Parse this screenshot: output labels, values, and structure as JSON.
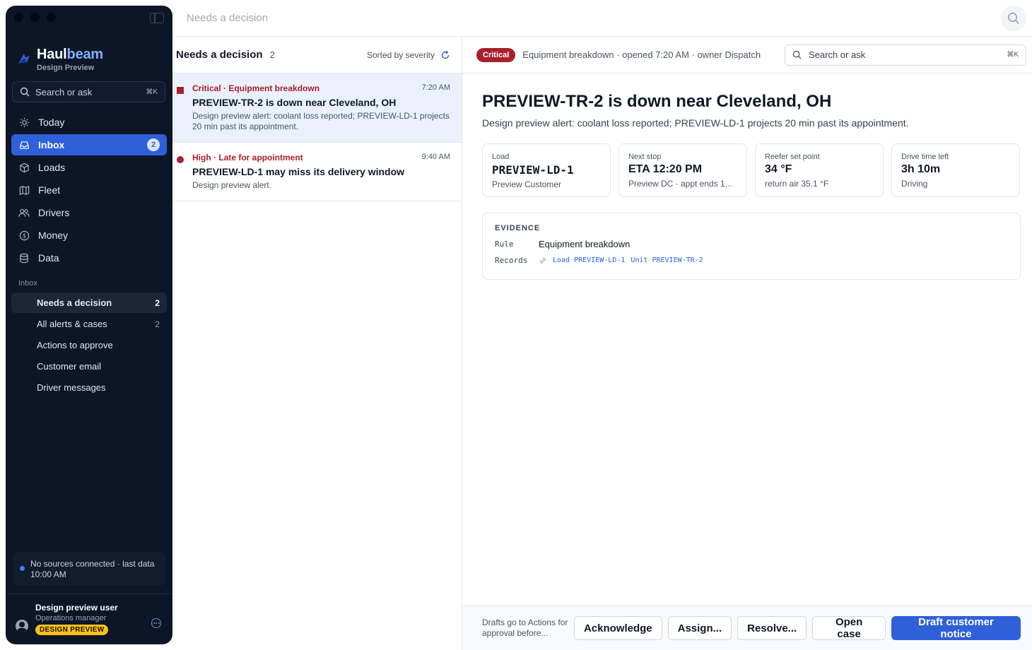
{
  "sidebar": {
    "brand": {
      "name_part1": "Haul",
      "name_part2": "beam",
      "subtitle": "Design Preview"
    },
    "search": {
      "placeholder": "Search or ask",
      "shortcut": "⌘K"
    },
    "nav": [
      {
        "label": "Today",
        "icon": "sun-icon"
      },
      {
        "label": "Inbox",
        "icon": "inbox-icon",
        "badge": "2",
        "active": true
      },
      {
        "label": "Loads",
        "icon": "box-icon"
      },
      {
        "label": "Fleet",
        "icon": "map-icon"
      },
      {
        "label": "Drivers",
        "icon": "users-icon"
      },
      {
        "label": "Money",
        "icon": "dollar-icon"
      },
      {
        "label": "Data",
        "icon": "database-icon"
      }
    ],
    "section_label": "Inbox",
    "sub_nav": [
      {
        "label": "Needs a decision",
        "count": "2",
        "active": true
      },
      {
        "label": "All alerts & cases",
        "count": "2"
      },
      {
        "label": "Actions to approve",
        "count": ""
      },
      {
        "label": "Customer email",
        "count": ""
      },
      {
        "label": "Driver messages",
        "count": ""
      }
    ],
    "status": "No sources connected · last data 10:00 AM",
    "user": {
      "name": "Design preview user",
      "role": "Operations manager",
      "badge": "DESIGN PREVIEW"
    }
  },
  "topbar": {
    "title": "Needs a decision"
  },
  "list": {
    "title": "Needs a decision",
    "count": "2",
    "sort_label": "Sorted by severity",
    "alerts": [
      {
        "tag": "Critical · Equipment breakdown",
        "time": "7:20 AM",
        "title": "PREVIEW-TR-2 is down near Cleveland, OH",
        "desc": "Design preview alert: coolant loss reported; PREVIEW-LD-1 projects 20 min past its appointment."
      },
      {
        "tag": "High · Late for appointment",
        "time": "9:40 AM",
        "title": "PREVIEW-LD-1 may miss its delivery window",
        "desc": "Design preview alert."
      }
    ]
  },
  "detail": {
    "severity": "Critical",
    "meta": "Equipment breakdown · opened 7:20 AM · owner Dispatch",
    "search": {
      "placeholder": "Search or ask",
      "shortcut": "⌘K"
    },
    "title": "PREVIEW-TR-2 is down near Cleveland, OH",
    "subtitle": "Design preview alert: coolant loss reported; PREVIEW-LD-1 projects 20 min past its appointment.",
    "cards": [
      {
        "label": "Load",
        "value": "PREVIEW-LD-1",
        "sub": "Preview Customer"
      },
      {
        "label": "Next stop",
        "value": "ETA 12:20 PM",
        "sub": "Preview DC · appt ends 1..."
      },
      {
        "label": "Reefer set point",
        "value": "34 °F",
        "sub": "return air 35.1 °F"
      },
      {
        "label": "Drive time left",
        "value": "3h 10m",
        "sub": "Driving"
      }
    ],
    "evidence": {
      "heading": "EVIDENCE",
      "rule_key": "Rule",
      "rule_value": "Equipment breakdown",
      "records_key": "Records",
      "record_load": "Load PREVIEW-LD-1",
      "record_unit": "Unit PREVIEW-TR-2"
    }
  },
  "actions": {
    "note": "Drafts go to Actions for approval before...",
    "acknowledge": "Acknowledge",
    "assign": "Assign...",
    "resolve": "Resolve...",
    "open_case": "Open case",
    "draft_notice": "Draft customer notice"
  },
  "colors": {
    "accent": "#2f5fd9",
    "critical": "#a8202c",
    "sidebar_bg": "#0d1626"
  }
}
